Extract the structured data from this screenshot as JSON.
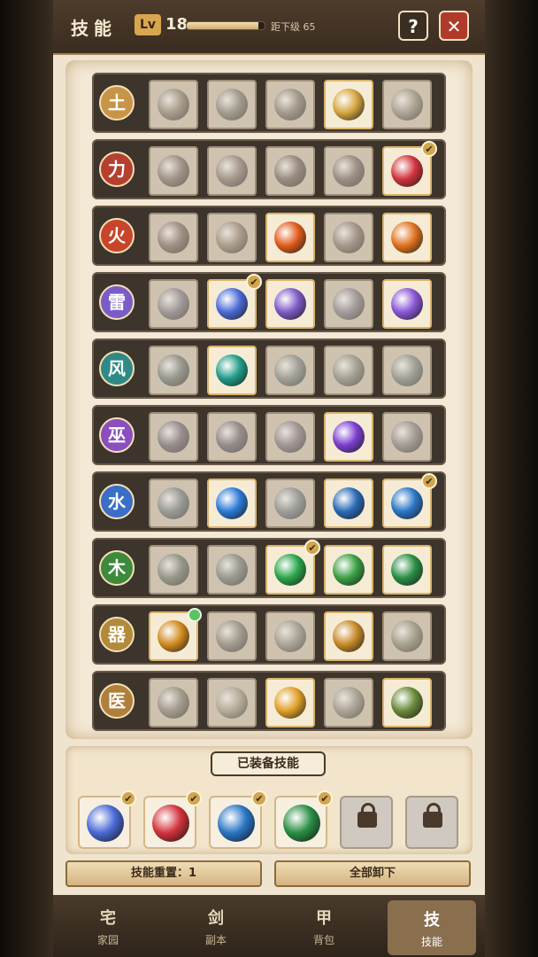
{
  "header": {
    "title": "技能",
    "lv_label": "Lv",
    "level": "18",
    "xp_fraction": 0.92,
    "next_level_text": "距下级 65",
    "help_label": "?",
    "close_label": "✕"
  },
  "skill_rows": [
    {
      "element": "土",
      "color": "#c89548",
      "orbs": [
        "#9b7b4c",
        "#8a7a60",
        "#8d7752",
        "#d5a640",
        "#a58a5e"
      ],
      "equipped": [
        false,
        false,
        false,
        true,
        false
      ]
    },
    {
      "element": "力",
      "color": "#b5402f",
      "orbs": [
        "#9b6650",
        "#a46e5a",
        "#8a5a4c",
        "#8f5f57",
        "#d2333c"
      ],
      "equipped": [
        false,
        false,
        false,
        false,
        true
      ]
    },
    {
      "element": "火",
      "color": "#c8442a",
      "orbs": [
        "#a85a40",
        "#b07848",
        "#e05a1a",
        "#a66b50",
        "#e0721e"
      ],
      "equipped": [
        false,
        false,
        true,
        false,
        true
      ]
    },
    {
      "element": "雷",
      "color": "#7b5cc7",
      "orbs": [
        "#7f74a2",
        "#4b6ad6",
        "#7e5ac7",
        "#8a76a8",
        "#8a56d6"
      ],
      "equipped": [
        false,
        true,
        true,
        false,
        true
      ]
    },
    {
      "element": "风",
      "color": "#2f8a86",
      "orbs": [
        "#587a74",
        "#1f9c88",
        "#6e8a80",
        "#7a8a64",
        "#6a8a86"
      ],
      "equipped": [
        false,
        true,
        false,
        false,
        false
      ]
    },
    {
      "element": "巫",
      "color": "#8a4ebf",
      "orbs": [
        "#7a5a96",
        "#725a90",
        "#8a6a96",
        "#7c3ed0",
        "#8a7a86"
      ],
      "equipped": [
        false,
        false,
        false,
        true,
        false
      ]
    },
    {
      "element": "水",
      "color": "#3a6ec7",
      "orbs": [
        "#5a7e9a",
        "#2a7ad6",
        "#5a86a6",
        "#2a6ab6",
        "#2a76c6"
      ],
      "equipped": [
        false,
        true,
        false,
        true,
        true
      ]
    },
    {
      "element": "木",
      "color": "#3c8a3c",
      "orbs": [
        "#5a7a5a",
        "#5a7e70",
        "#2aa64a",
        "#3aa044",
        "#2a8e44"
      ],
      "equipped": [
        false,
        false,
        true,
        true,
        true
      ]
    },
    {
      "element": "器",
      "color": "#b18a3c",
      "orbs": [
        "#d28a1e",
        "#8a7a5a",
        "#9a8a70",
        "#c88a2a",
        "#8a8a4a"
      ],
      "equipped": [
        true,
        false,
        false,
        true,
        false
      ]
    },
    {
      "element": "医",
      "color": "#b07f3c",
      "orbs": [
        "#8a7a5a",
        "#b49a5a",
        "#e0a02a",
        "#9a8a70",
        "#6a8a3a"
      ],
      "equipped": [
        false,
        false,
        true,
        false,
        true
      ]
    }
  ],
  "equipped_panel": {
    "title": "已装备技能",
    "slots": [
      {
        "color": "#4b6ad6",
        "locked": false
      },
      {
        "color": "#d2333c",
        "locked": false
      },
      {
        "color": "#2a76c6",
        "locked": false
      },
      {
        "color": "#2a8e44",
        "locked": false
      },
      {
        "color": "",
        "locked": true
      },
      {
        "color": "",
        "locked": true
      }
    ]
  },
  "actions": {
    "reset_label": "技能重置：1",
    "unequip_all_label": "全部卸下"
  },
  "nav": [
    {
      "icon": "宅",
      "label": "家园",
      "active": false
    },
    {
      "icon": "剑",
      "label": "副本",
      "active": false
    },
    {
      "icon": "甲",
      "label": "背包",
      "active": false
    },
    {
      "icon": "技",
      "label": "技能",
      "active": true
    }
  ]
}
